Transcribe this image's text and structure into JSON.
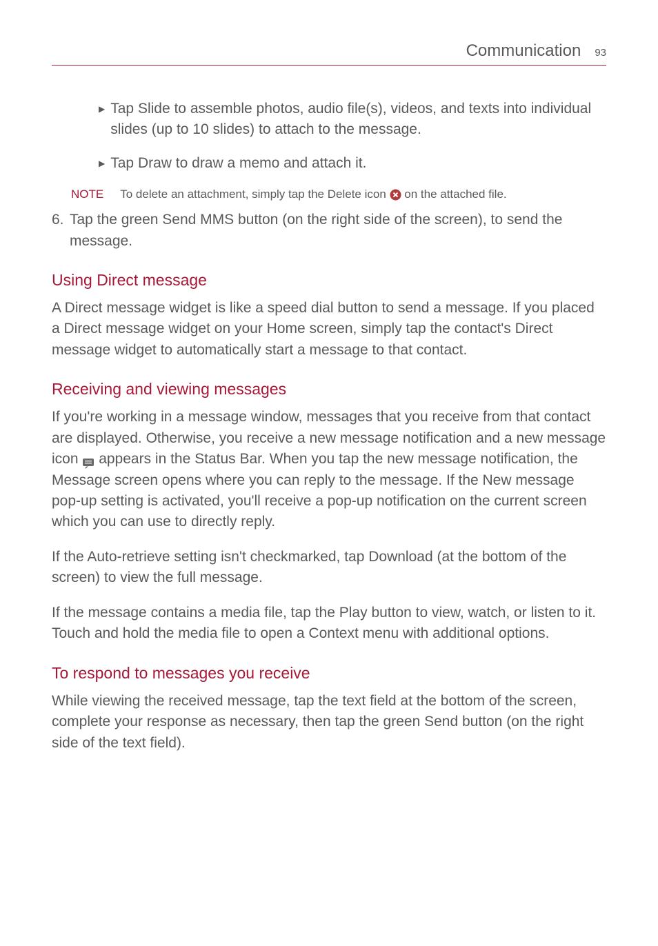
{
  "header": {
    "title": "Communication",
    "page": "93"
  },
  "bullets": {
    "slide": {
      "bold": "Slide",
      "pre": "Tap ",
      "post": " to assemble photos, audio file(s), videos, and texts into individual slides (up to 10 slides) to attach to the message."
    },
    "draw": {
      "bold": "Draw",
      "pre": "Tap ",
      "post": " to draw a memo and attach it."
    }
  },
  "note": {
    "label": "NOTE",
    "pre": "To delete an attachment, simply tap the ",
    "bold": "Delete",
    "mid": " icon ",
    "post": " on the attached file."
  },
  "step6": {
    "num": "6.",
    "pre": "Tap the green ",
    "bold": "Send MMS",
    "post": " button (on the right side of the screen), to send the message."
  },
  "h1": "Using Direct message",
  "p1": "A Direct message widget is like a speed dial button to send a message. If you placed a Direct message widget on your Home screen, simply tap the contact's Direct message widget to automatically start a message to that contact.",
  "h2": "Receiving and viewing messages",
  "p2": {
    "a": "If you're working in a message window, messages that you receive from that contact are displayed. Otherwise, you receive a new message notification and a new message icon ",
    "b": " appears in the Status Bar. When you tap the new message notification, the Message screen opens where you can reply to the message. If the ",
    "bold": "New message",
    "c": " pop-up setting is activated, you'll receive a pop-up notification on the current screen which you can use to directly reply."
  },
  "p3": {
    "a": "If the Auto-retrieve setting isn't checkmarked, tap ",
    "bold": "Download",
    "b": " (at the bottom of the screen) to view the full message."
  },
  "p4": {
    "a": "If the message contains a media file, tap the ",
    "bold": "Play",
    "b": " button to view, watch, or listen to it. Touch and hold the media file to open a Context menu with additional options."
  },
  "h3": "To respond to messages you receive",
  "p5": {
    "a": "While viewing the received message, tap the text field at the bottom of the screen, complete your response as necessary, then tap the green ",
    "bold": "Send",
    "b": " button (on the right side of the text field)."
  }
}
